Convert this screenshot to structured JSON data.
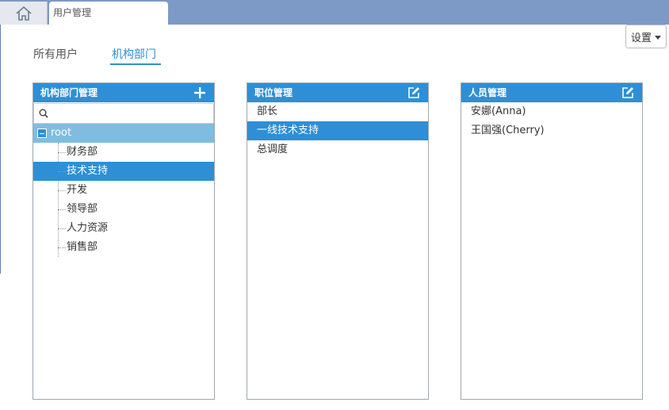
{
  "tabs": {
    "home_icon": "home-icon",
    "page_tab_label": "用户管理"
  },
  "settings": {
    "label": "设置"
  },
  "subtabs": {
    "all_users": "所有用户",
    "org_dept": "机构部门"
  },
  "org_panel": {
    "title": "机构部门管理",
    "search": {
      "placeholder": "",
      "value": ""
    },
    "root": "root",
    "children": [
      "财务部",
      "技术支持",
      "开发",
      "领导部",
      "人力资源",
      "销售部"
    ],
    "selected_index": 1
  },
  "position_panel": {
    "title": "职位管理",
    "items": [
      "部长",
      "一线技术支持",
      "总调度"
    ],
    "selected_index": 1
  },
  "people_panel": {
    "title": "人员管理",
    "items": [
      "安娜(Anna)",
      "王国强(Cherry)"
    ]
  },
  "colors": {
    "accent": "#2e8fd6",
    "topbar": "#7d99c5",
    "root_highlight": "#7fbde0"
  }
}
